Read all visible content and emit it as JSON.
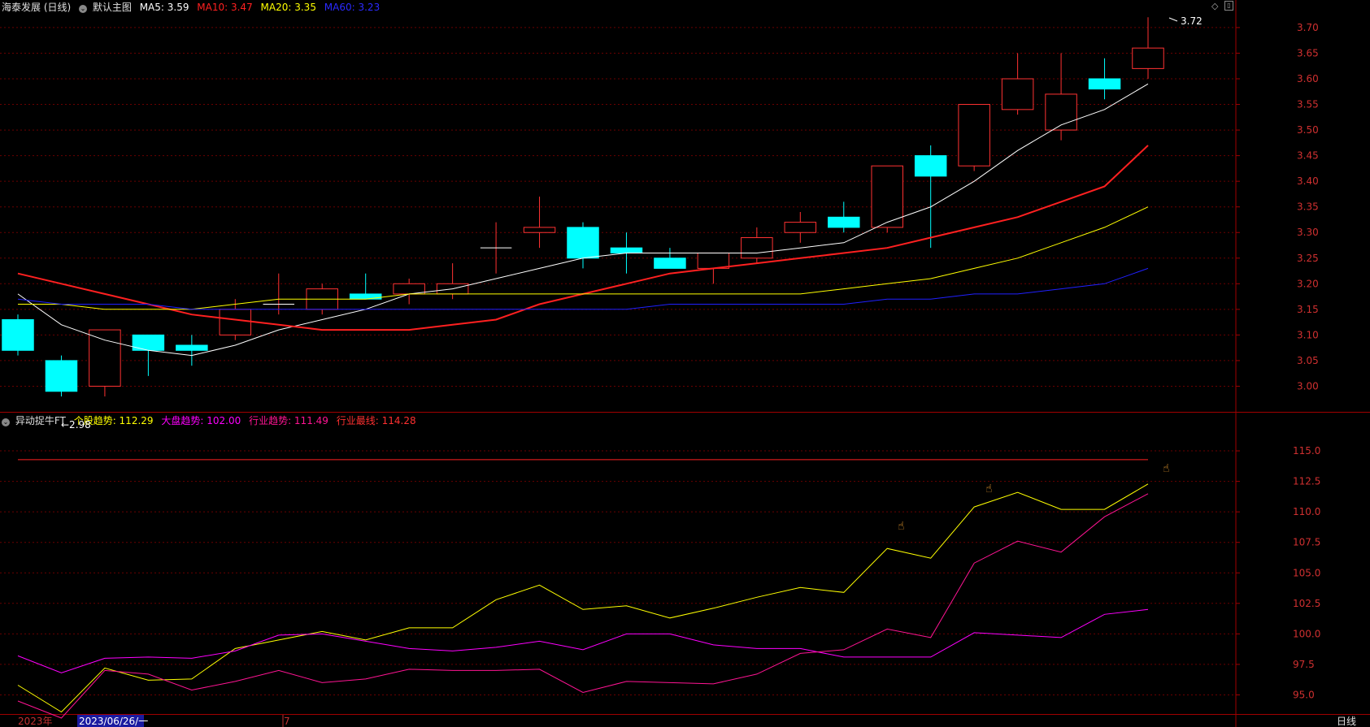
{
  "header": {
    "stock_title": "海泰发展 (日线)",
    "template": "默认主图",
    "ma5": "MA5: 3.59",
    "ma10": "MA10: 3.47",
    "ma20": "MA20: 3.35",
    "ma60": "MA60: 3.23",
    "colors": {
      "ma5": "#ffffff",
      "ma10": "#ff2020",
      "ma20": "#ffff00",
      "ma60": "#2020ff"
    }
  },
  "indicator_header": {
    "name": "异动捉牛FT",
    "stock_trend": "个股趋势: 112.29",
    "market_trend": "大盘趋势: 102.00",
    "industry_trend": "行业趋势: 111.49",
    "industry_top": "行业最线: 114.28",
    "colors": {
      "stock": "#ffff00",
      "market": "#ff00ff",
      "industry": "#ff1493",
      "top": "#ff3030"
    }
  },
  "footer": {
    "year": "2023年",
    "cursor_date": "2023/06/26/一",
    "month_mark": "7",
    "period": "日线"
  },
  "annotations": {
    "low_label": "←2.98",
    "high_label": "3.72"
  },
  "chart_data": [
    {
      "type": "candlestick",
      "ylim": [
        2.95,
        3.73
      ],
      "yticks": [
        "3.70",
        "3.65",
        "3.60",
        "3.55",
        "3.50",
        "3.45",
        "3.40",
        "3.35",
        "3.30",
        "3.25",
        "3.20",
        "3.15",
        "3.10",
        "3.05",
        "3.00"
      ],
      "candles": [
        {
          "o": 3.13,
          "h": 3.14,
          "l": 3.06,
          "c": 3.07
        },
        {
          "o": 3.05,
          "h": 3.06,
          "l": 2.98,
          "c": 2.99
        },
        {
          "o": 3.0,
          "h": 3.11,
          "l": 2.98,
          "c": 3.11
        },
        {
          "o": 3.1,
          "h": 3.1,
          "l": 3.02,
          "c": 3.07
        },
        {
          "o": 3.08,
          "h": 3.1,
          "l": 3.04,
          "c": 3.07
        },
        {
          "o": 3.1,
          "h": 3.17,
          "l": 3.09,
          "c": 3.15
        },
        {
          "o": 3.16,
          "h": 3.22,
          "l": 3.14,
          "c": 3.16
        },
        {
          "o": 3.15,
          "h": 3.2,
          "l": 3.14,
          "c": 3.19
        },
        {
          "o": 3.18,
          "h": 3.22,
          "l": 3.17,
          "c": 3.17
        },
        {
          "o": 3.18,
          "h": 3.21,
          "l": 3.16,
          "c": 3.2
        },
        {
          "o": 3.18,
          "h": 3.24,
          "l": 3.17,
          "c": 3.2
        },
        {
          "o": 3.27,
          "h": 3.32,
          "l": 3.22,
          "c": 3.27
        },
        {
          "o": 3.3,
          "h": 3.37,
          "l": 3.27,
          "c": 3.31
        },
        {
          "o": 3.31,
          "h": 3.32,
          "l": 3.23,
          "c": 3.25
        },
        {
          "o": 3.27,
          "h": 3.3,
          "l": 3.22,
          "c": 3.26
        },
        {
          "o": 3.25,
          "h": 3.27,
          "l": 3.23,
          "c": 3.23
        },
        {
          "o": 3.23,
          "h": 3.26,
          "l": 3.2,
          "c": 3.26
        },
        {
          "o": 3.25,
          "h": 3.31,
          "l": 3.24,
          "c": 3.29
        },
        {
          "o": 3.3,
          "h": 3.34,
          "l": 3.28,
          "c": 3.32
        },
        {
          "o": 3.33,
          "h": 3.36,
          "l": 3.3,
          "c": 3.31
        },
        {
          "o": 3.31,
          "h": 3.43,
          "l": 3.3,
          "c": 3.43
        },
        {
          "o": 3.45,
          "h": 3.47,
          "l": 3.27,
          "c": 3.41
        },
        {
          "o": 3.43,
          "h": 3.55,
          "l": 3.42,
          "c": 3.55
        },
        {
          "o": 3.54,
          "h": 3.65,
          "l": 3.53,
          "c": 3.6
        },
        {
          "o": 3.5,
          "h": 3.65,
          "l": 3.48,
          "c": 3.57
        },
        {
          "o": 3.6,
          "h": 3.64,
          "l": 3.56,
          "c": 3.58
        },
        {
          "o": 3.62,
          "h": 3.72,
          "l": 3.6,
          "c": 3.66
        }
      ],
      "series": [
        {
          "name": "MA5",
          "values": [
            3.18,
            3.12,
            3.09,
            3.07,
            3.06,
            3.08,
            3.11,
            3.13,
            3.15,
            3.18,
            3.19,
            3.21,
            3.23,
            3.25,
            3.26,
            3.26,
            3.26,
            3.26,
            3.27,
            3.28,
            3.32,
            3.35,
            3.4,
            3.46,
            3.51,
            3.54,
            3.59
          ]
        },
        {
          "name": "MA10",
          "values": [
            3.22,
            3.2,
            3.18,
            3.16,
            3.14,
            3.13,
            3.12,
            3.11,
            3.11,
            3.11,
            3.12,
            3.13,
            3.16,
            3.18,
            3.2,
            3.22,
            3.23,
            3.24,
            3.25,
            3.26,
            3.27,
            3.29,
            3.31,
            3.33,
            3.36,
            3.39,
            3.47
          ]
        },
        {
          "name": "MA20",
          "values": [
            3.16,
            3.16,
            3.15,
            3.15,
            3.15,
            3.16,
            3.17,
            3.17,
            3.17,
            3.18,
            3.18,
            3.18,
            3.18,
            3.18,
            3.18,
            3.18,
            3.18,
            3.18,
            3.18,
            3.19,
            3.2,
            3.21,
            3.23,
            3.25,
            3.28,
            3.31,
            3.35
          ]
        },
        {
          "name": "MA60",
          "values": [
            3.17,
            3.16,
            3.16,
            3.16,
            3.15,
            3.15,
            3.15,
            3.15,
            3.15,
            3.15,
            3.15,
            3.15,
            3.15,
            3.15,
            3.15,
            3.16,
            3.16,
            3.16,
            3.16,
            3.16,
            3.17,
            3.17,
            3.18,
            3.18,
            3.19,
            3.2,
            3.23
          ]
        }
      ]
    },
    {
      "type": "line",
      "ylim": [
        93.5,
        117.0
      ],
      "yticks": [
        "115.0",
        "112.5",
        "110.0",
        "107.5",
        "105.0",
        "102.5",
        "100.0",
        "97.5",
        "95.0"
      ],
      "reference_value": 114.28,
      "series": [
        {
          "name": "个股趋势",
          "values": [
            95.8,
            93.6,
            97.2,
            96.2,
            96.3,
            98.8,
            99.5,
            100.2,
            99.5,
            100.5,
            100.5,
            102.8,
            104.0,
            102.0,
            102.3,
            101.3,
            102.1,
            103.0,
            103.8,
            103.4,
            107.0,
            106.2,
            110.4,
            111.6,
            110.2,
            110.2,
            112.29
          ]
        },
        {
          "name": "大盘趋势",
          "values": [
            98.2,
            96.8,
            98.0,
            98.1,
            98.0,
            98.6,
            99.9,
            100.0,
            99.4,
            98.8,
            98.6,
            98.9,
            99.4,
            98.7,
            100.0,
            100.0,
            99.1,
            98.8,
            98.8,
            98.1,
            98.1,
            98.1,
            100.1,
            99.9,
            99.7,
            101.6,
            102.0
          ]
        },
        {
          "name": "行业趋势",
          "values": [
            94.5,
            93.1,
            97.0,
            96.7,
            95.4,
            96.1,
            97.0,
            96.0,
            96.3,
            97.1,
            97.0,
            97.0,
            97.1,
            95.2,
            96.1,
            96.0,
            95.9,
            96.7,
            98.4,
            98.7,
            100.4,
            99.7,
            105.8,
            107.6,
            106.7,
            109.6,
            111.49
          ]
        }
      ]
    }
  ]
}
